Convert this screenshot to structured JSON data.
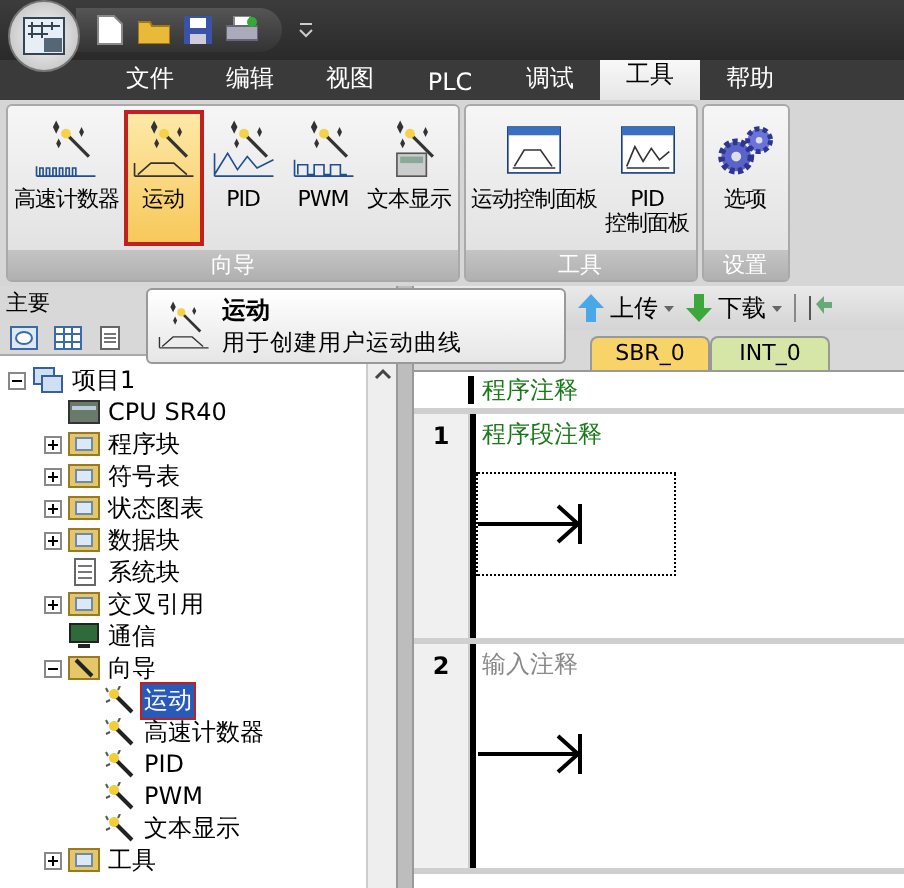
{
  "menu_tabs": [
    {
      "label": "文件",
      "selected": false
    },
    {
      "label": "编辑",
      "selected": false
    },
    {
      "label": "视图",
      "selected": false
    },
    {
      "label": "PLC",
      "selected": false
    },
    {
      "label": "调试",
      "selected": false
    },
    {
      "label": "工具",
      "selected": true
    },
    {
      "label": "帮助",
      "selected": false
    }
  ],
  "ribbon": {
    "groups": [
      {
        "title": "向导",
        "buttons": [
          {
            "lines": [
              "高速计数器"
            ],
            "kind": "counter",
            "selected": false
          },
          {
            "lines": [
              "运动"
            ],
            "kind": "motion",
            "selected": true
          },
          {
            "lines": [
              "PID"
            ],
            "kind": "pid",
            "selected": false
          },
          {
            "lines": [
              "PWM"
            ],
            "kind": "pwm",
            "selected": false
          },
          {
            "lines": [
              "文本显示"
            ],
            "kind": "text",
            "selected": false
          }
        ]
      },
      {
        "title": "工具",
        "buttons": [
          {
            "lines": [
              "运动控制面板"
            ],
            "kind": "motion-panel",
            "selected": false
          },
          {
            "lines": [
              "PID",
              "控制面板"
            ],
            "kind": "pid-panel",
            "selected": false
          }
        ]
      },
      {
        "title": "设置",
        "buttons": [
          {
            "lines": [
              "选项"
            ],
            "kind": "options",
            "selected": false
          }
        ]
      }
    ]
  },
  "panel": {
    "title": "主要"
  },
  "tooltip": {
    "title": "运动",
    "description": "用于创建用户运动曲线"
  },
  "tree": [
    {
      "label": "项目1",
      "kind": "project",
      "expanded": true,
      "children": [
        {
          "label": "CPU SR40",
          "kind": "cpu",
          "selected": false
        },
        {
          "label": "程序块",
          "kind": "folder",
          "expanded": false,
          "selected": false
        },
        {
          "label": "符号表",
          "kind": "folder",
          "expanded": false,
          "selected": false
        },
        {
          "label": "状态图表",
          "kind": "folder",
          "expanded": false,
          "selected": false
        },
        {
          "label": "数据块",
          "kind": "folder",
          "expanded": false,
          "selected": false
        },
        {
          "label": "系统块",
          "kind": "doc",
          "selected": false
        },
        {
          "label": "交叉引用",
          "kind": "folder",
          "expanded": false,
          "selected": false
        },
        {
          "label": "通信",
          "kind": "comm",
          "selected": false
        },
        {
          "label": "向导",
          "kind": "wizard",
          "expanded": true,
          "selected": false,
          "children": [
            {
              "label": "运动",
              "kind": "wand",
              "selected": true
            },
            {
              "label": "高速计数器",
              "kind": "wand",
              "selected": false
            },
            {
              "label": "PID",
              "kind": "wand",
              "selected": false
            },
            {
              "label": "PWM",
              "kind": "wand",
              "selected": false
            },
            {
              "label": "文本显示",
              "kind": "wand",
              "selected": false
            }
          ]
        },
        {
          "label": "工具",
          "kind": "folder",
          "expanded": false,
          "selected": false
        }
      ],
      "selected": false
    }
  ],
  "toolbar": [
    {
      "label": "上传",
      "kind": "upload"
    },
    {
      "label": "下载",
      "kind": "download"
    }
  ],
  "editor_tabs": [
    {
      "label": "SBR_0",
      "color": "#f8d468"
    },
    {
      "label": "INT_0",
      "color": "#d6e6a6"
    }
  ],
  "editor": {
    "program_comment": "程序注释",
    "networks": [
      {
        "number": "1",
        "comment": "程序段注释",
        "comment_placeholder": false,
        "selected": true
      },
      {
        "number": "2",
        "comment": "输入注释",
        "comment_placeholder": true,
        "selected": false
      }
    ]
  }
}
